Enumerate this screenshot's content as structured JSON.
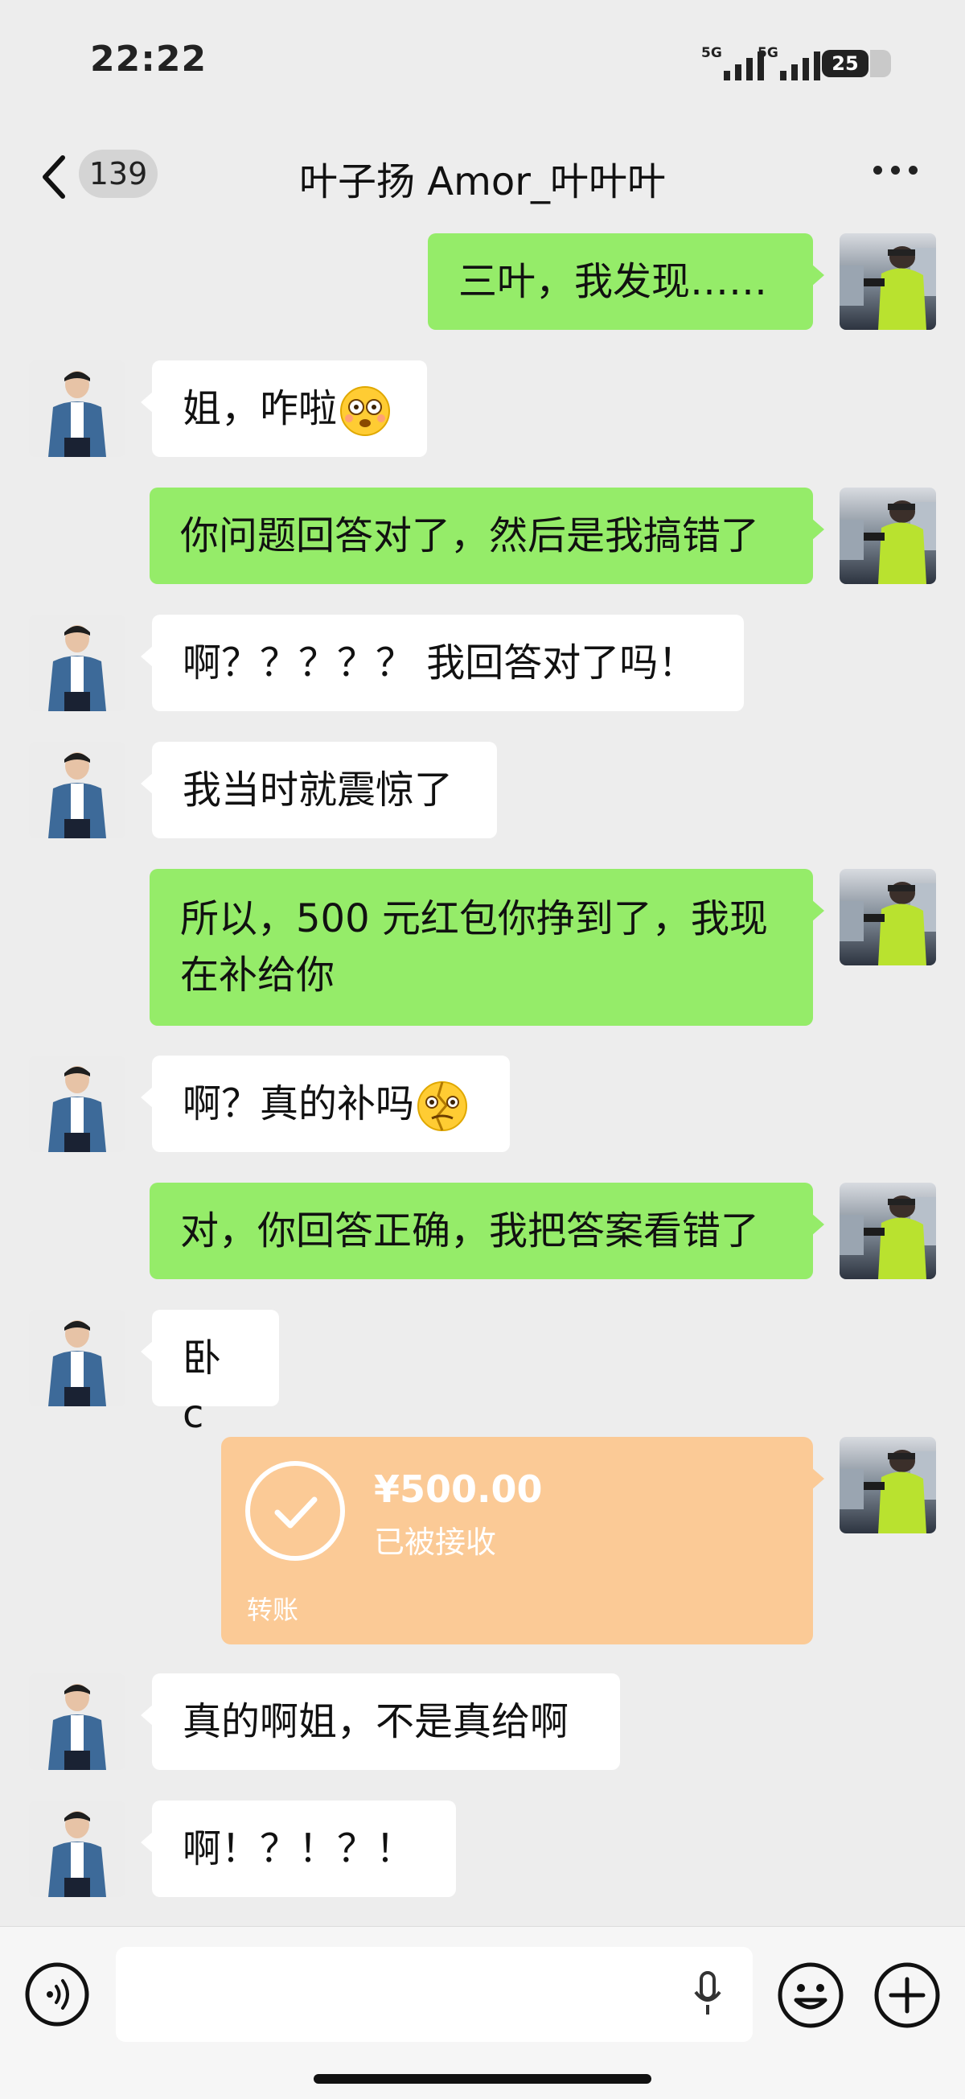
{
  "status_bar": {
    "time": "22:22",
    "signal_1": "5G",
    "signal_2": "5G",
    "battery": "25"
  },
  "header": {
    "back_count": "139",
    "title": "叶子扬 Amor_叶叶叶",
    "more_icon": "more-icon"
  },
  "messages": [
    {
      "side": "out",
      "text": "三叶，我发现……"
    },
    {
      "side": "in",
      "text": "姐，咋啦",
      "emoji": "flushed-face"
    },
    {
      "side": "out",
      "text": "你问题回答对了，然后是我搞错了"
    },
    {
      "side": "in",
      "text": "啊？？？？？ 我回答对了吗！"
    },
    {
      "side": "in",
      "text": "我当时就震惊了"
    },
    {
      "side": "out",
      "text": "所以，500 元红包你挣到了，我现\n在补给你"
    },
    {
      "side": "in",
      "text": "啊？真的补吗",
      "emoji": "broken-face"
    },
    {
      "side": "out",
      "text": "对，你回答正确，我把答案看错了"
    },
    {
      "side": "in",
      "text": "卧 c"
    },
    {
      "side": "in",
      "text": "真的啊姐，不是真给啊"
    },
    {
      "side": "in",
      "text": "啊！？！？！"
    }
  ],
  "transfer": {
    "amount": "¥500.00",
    "status": "已被接收",
    "type": "转账",
    "color": "#fbca96"
  },
  "input_bar": {
    "voice_icon": "voice-icon",
    "mic_icon": "mic-icon",
    "emoji_icon": "emoji-icon",
    "plus_icon": "plus-icon"
  },
  "colors": {
    "outgoing_bubble": "#95ec69",
    "incoming_bubble": "#ffffff",
    "background": "#ededed"
  }
}
